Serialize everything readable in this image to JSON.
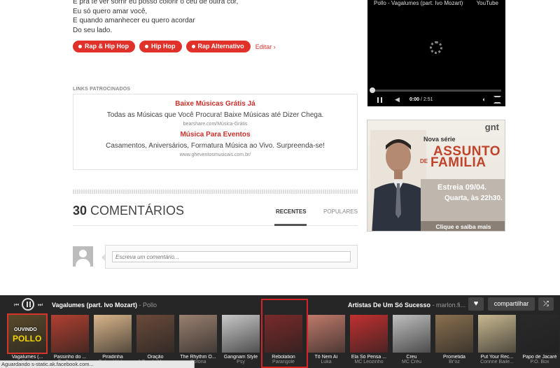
{
  "lyrics": {
    "lines": [
      "E pra te ver sorrir eu posso colorir o céu de outra cor,",
      "Eu só quero amar você,",
      "E quando amanhecer eu quero acordar",
      "Do seu lado."
    ]
  },
  "tags": {
    "items": [
      "Rap & Hip Hop",
      "Hip Hop",
      "Rap Alternativo"
    ],
    "edit_label": "Editar ›"
  },
  "sponsored": {
    "header": "LINKS PATROCINADOS",
    "ads": [
      {
        "title": "Baixe Músicas Grátis Já",
        "description": "Todas as Músicas que Você Procura! Baixe Músicas até Dizer Chega.",
        "url": "bearshare.com/Música-Grátis"
      },
      {
        "title": "Música Para Eventos",
        "description": "Casamentos, Aniversários, Formatura Música ao Vivo. Surpreenda-se!",
        "url": "www.gheventosmusicais.com.br/"
      }
    ]
  },
  "comments": {
    "count": "30",
    "label": "COMENTÁRIOS",
    "tab_recent": "RECENTES",
    "tab_popular": "POPULARES",
    "input_placeholder": "Escreva um comentário..."
  },
  "video": {
    "title": "Pollo - Vagalumes (part. Ivo Mozart)",
    "brand": "YouTube",
    "current_time": "0:00",
    "duration": "/ 2:51"
  },
  "ad": {
    "brand": "gnt",
    "kicker": "Nova série",
    "title_line1": "ASSUNTO",
    "title_de": "DE",
    "title_line2": "FAMILIA",
    "premiere": "Estreia 09/04.",
    "schedule": "Quarta, às 22h30.",
    "cta": "Clique e saiba mais"
  },
  "player": {
    "now_playing_title": "Vagalumes (part. Ivo Mozart)",
    "now_playing_artist": "- Pollo",
    "artists_label": "Artistas De Um Só Sucesso",
    "artists_by": "- marlon.fi...",
    "share_label": "compartilhar",
    "ouvindo_label": "OUVINDO",
    "ouvindo_logo": "POLLO",
    "tracks": [
      {
        "title": "Vagalumes (...",
        "artist": "Pollo",
        "color": "#5a4a2a"
      },
      {
        "title": "Passinho do ...",
        "artist": "Os Caretas",
        "color": "#b04030"
      },
      {
        "title": "Piradinha",
        "artist": "Gabriel Valim",
        "color": "#d9b58a"
      },
      {
        "title": "Oração",
        "artist": "A Banda Mais ...",
        "color": "#6a4a3a"
      },
      {
        "title": "The Rhythm O...",
        "artist": "Corona",
        "color": "#9a8070"
      },
      {
        "title": "Gangnam Style",
        "artist": "Psy",
        "color": "#c8c8c8"
      },
      {
        "title": "Rebolation",
        "artist": "Parangolé",
        "color": "#7a2a2a"
      },
      {
        "title": "Tô Nem Aí",
        "artist": "Luka",
        "color": "#c07a6a"
      },
      {
        "title": "Ela Só Pensa ...",
        "artist": "MC Leozinho",
        "color": "#c03030"
      },
      {
        "title": "Creu",
        "artist": "MC Créu",
        "color": "#bfbfbf"
      },
      {
        "title": "Prometida",
        "artist": "Br'oz",
        "color": "#8a7050"
      },
      {
        "title": "Put Your Rec...",
        "artist": "Corinne Baile...",
        "color": "#c8b890"
      },
      {
        "title": "Papo de Jacaré",
        "artist": "P.O. Box",
        "color": "#2a2a2a"
      }
    ]
  },
  "status": {
    "text": "Aguardando s-static.ak.facebook.com..."
  }
}
